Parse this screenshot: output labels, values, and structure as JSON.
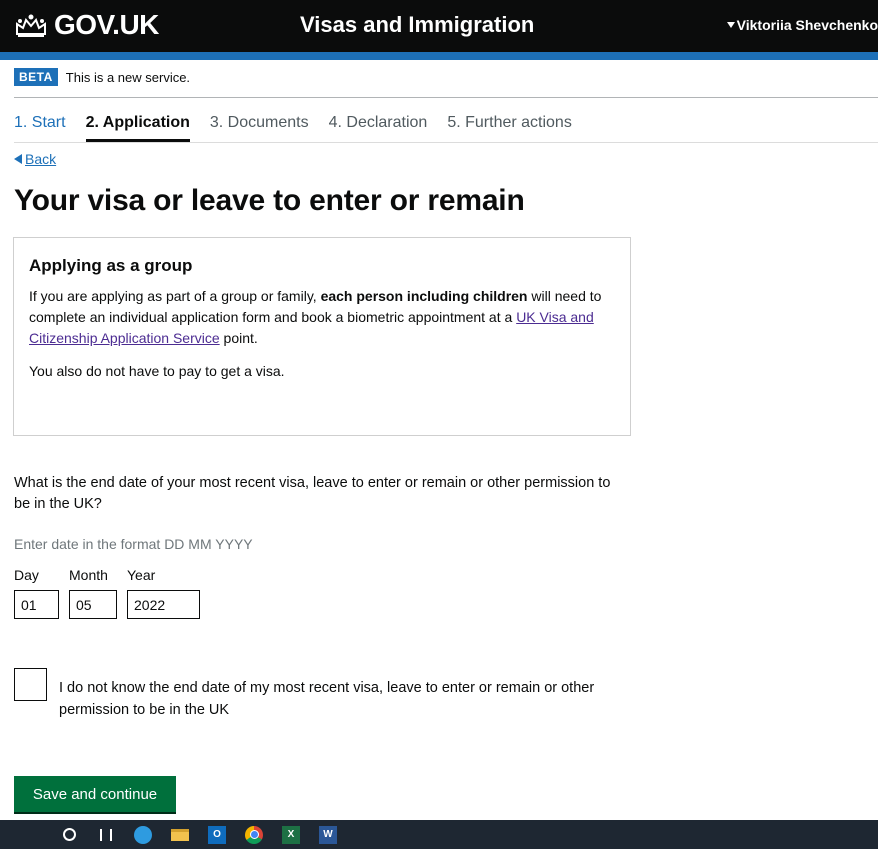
{
  "header": {
    "logo_text": "GOV.UK",
    "service_name": "Visas and Immigration",
    "user_name": "Viktoriia Shevchenko",
    "brand_color": "#0b0c0c",
    "accent_color": "#1d70b8"
  },
  "beta": {
    "tag": "BETA",
    "text": "This is a new service."
  },
  "steps": [
    {
      "label": "1. Start",
      "state": "done"
    },
    {
      "label": "2. Application",
      "state": "current"
    },
    {
      "label": "3. Documents",
      "state": "upcoming"
    },
    {
      "label": "4. Declaration",
      "state": "upcoming"
    },
    {
      "label": "5. Further actions",
      "state": "upcoming"
    }
  ],
  "back": {
    "label": "Back"
  },
  "page_title": "Your visa or leave to enter or remain",
  "panel": {
    "title": "Applying as a group",
    "p1_before": "If you are applying as part of a group or family, ",
    "p1_bold": "each person including children",
    "p1_middle": " will need to complete an individual application form and book a biometric appointment at a ",
    "p1_link": "UK Visa and Citizenship Application Service",
    "p1_after": " point.",
    "p2": "You also do not have to pay to get a visa."
  },
  "question": {
    "text": "What is the end date of your most recent visa, leave to enter or remain or other permission to be in the UK?",
    "hint": "Enter date in the format DD MM YYYY",
    "day_label": "Day",
    "month_label": "Month",
    "year_label": "Year",
    "day_value": "01",
    "month_value": "05",
    "year_value": "2022"
  },
  "checkbox": {
    "label": "I do not know the end date of my most recent visa, leave to enter or remain or other permission to be in the UK",
    "checked": false
  },
  "save_button": {
    "label": "Save and continue",
    "color": "#00703c"
  },
  "taskbar": {
    "icons": [
      "search-icon",
      "task-view-icon",
      "edge-icon",
      "file-explorer-icon",
      "outlook-icon",
      "chrome-icon",
      "excel-icon",
      "word-icon"
    ]
  }
}
